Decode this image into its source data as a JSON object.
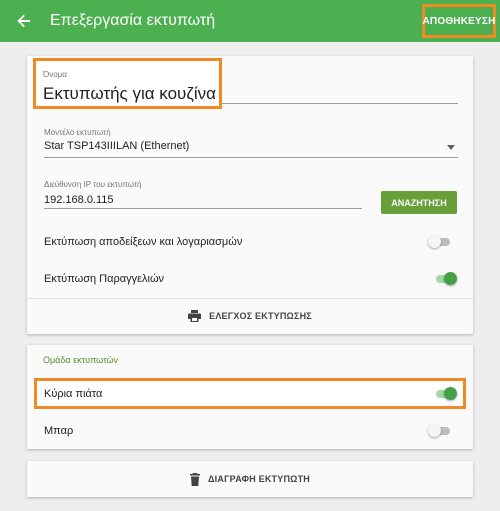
{
  "appbar": {
    "title": "Επεξεργασία εκτυπωτή",
    "save_label": "ΑΠΟΘΗΚΕΥΣΗ",
    "back_icon": "arrow-back-icon",
    "accent": "#4caf50",
    "highlight": "#f08a24"
  },
  "form": {
    "name": {
      "label": "Όνομα",
      "value": "Εκτυπωτής για κουζίνα"
    },
    "model": {
      "label": "Μοντέλο εκτυπωτή",
      "value": "Star TSP143IIILAN (Ethernet)"
    },
    "ip": {
      "label": "Διεύθυνση IP του εκτυπωτή",
      "value": "192.168.0.115",
      "search_label": "ΑΝΑΖΗΤΗΣΗ"
    },
    "print_receipts": {
      "label": "Εκτύπωση αποδείξεων και λογαριασμών",
      "on": false
    },
    "print_orders": {
      "label": "Εκτύπωση Παραγγελιών",
      "on": true
    },
    "test_print_label": "ΕΛΕΓΧΟΣ ΕΚΤΥΠΩΣΗΣ"
  },
  "printer_group": {
    "title": "Ομάδα εκτυπωτών",
    "items": [
      {
        "label": "Κύρια πιάτα",
        "on": true
      },
      {
        "label": "Μπαρ",
        "on": false
      }
    ]
  },
  "delete_label": "ΔΙΑΓΡΑΦΗ ΕΚΤΥΠΩΤΗ"
}
